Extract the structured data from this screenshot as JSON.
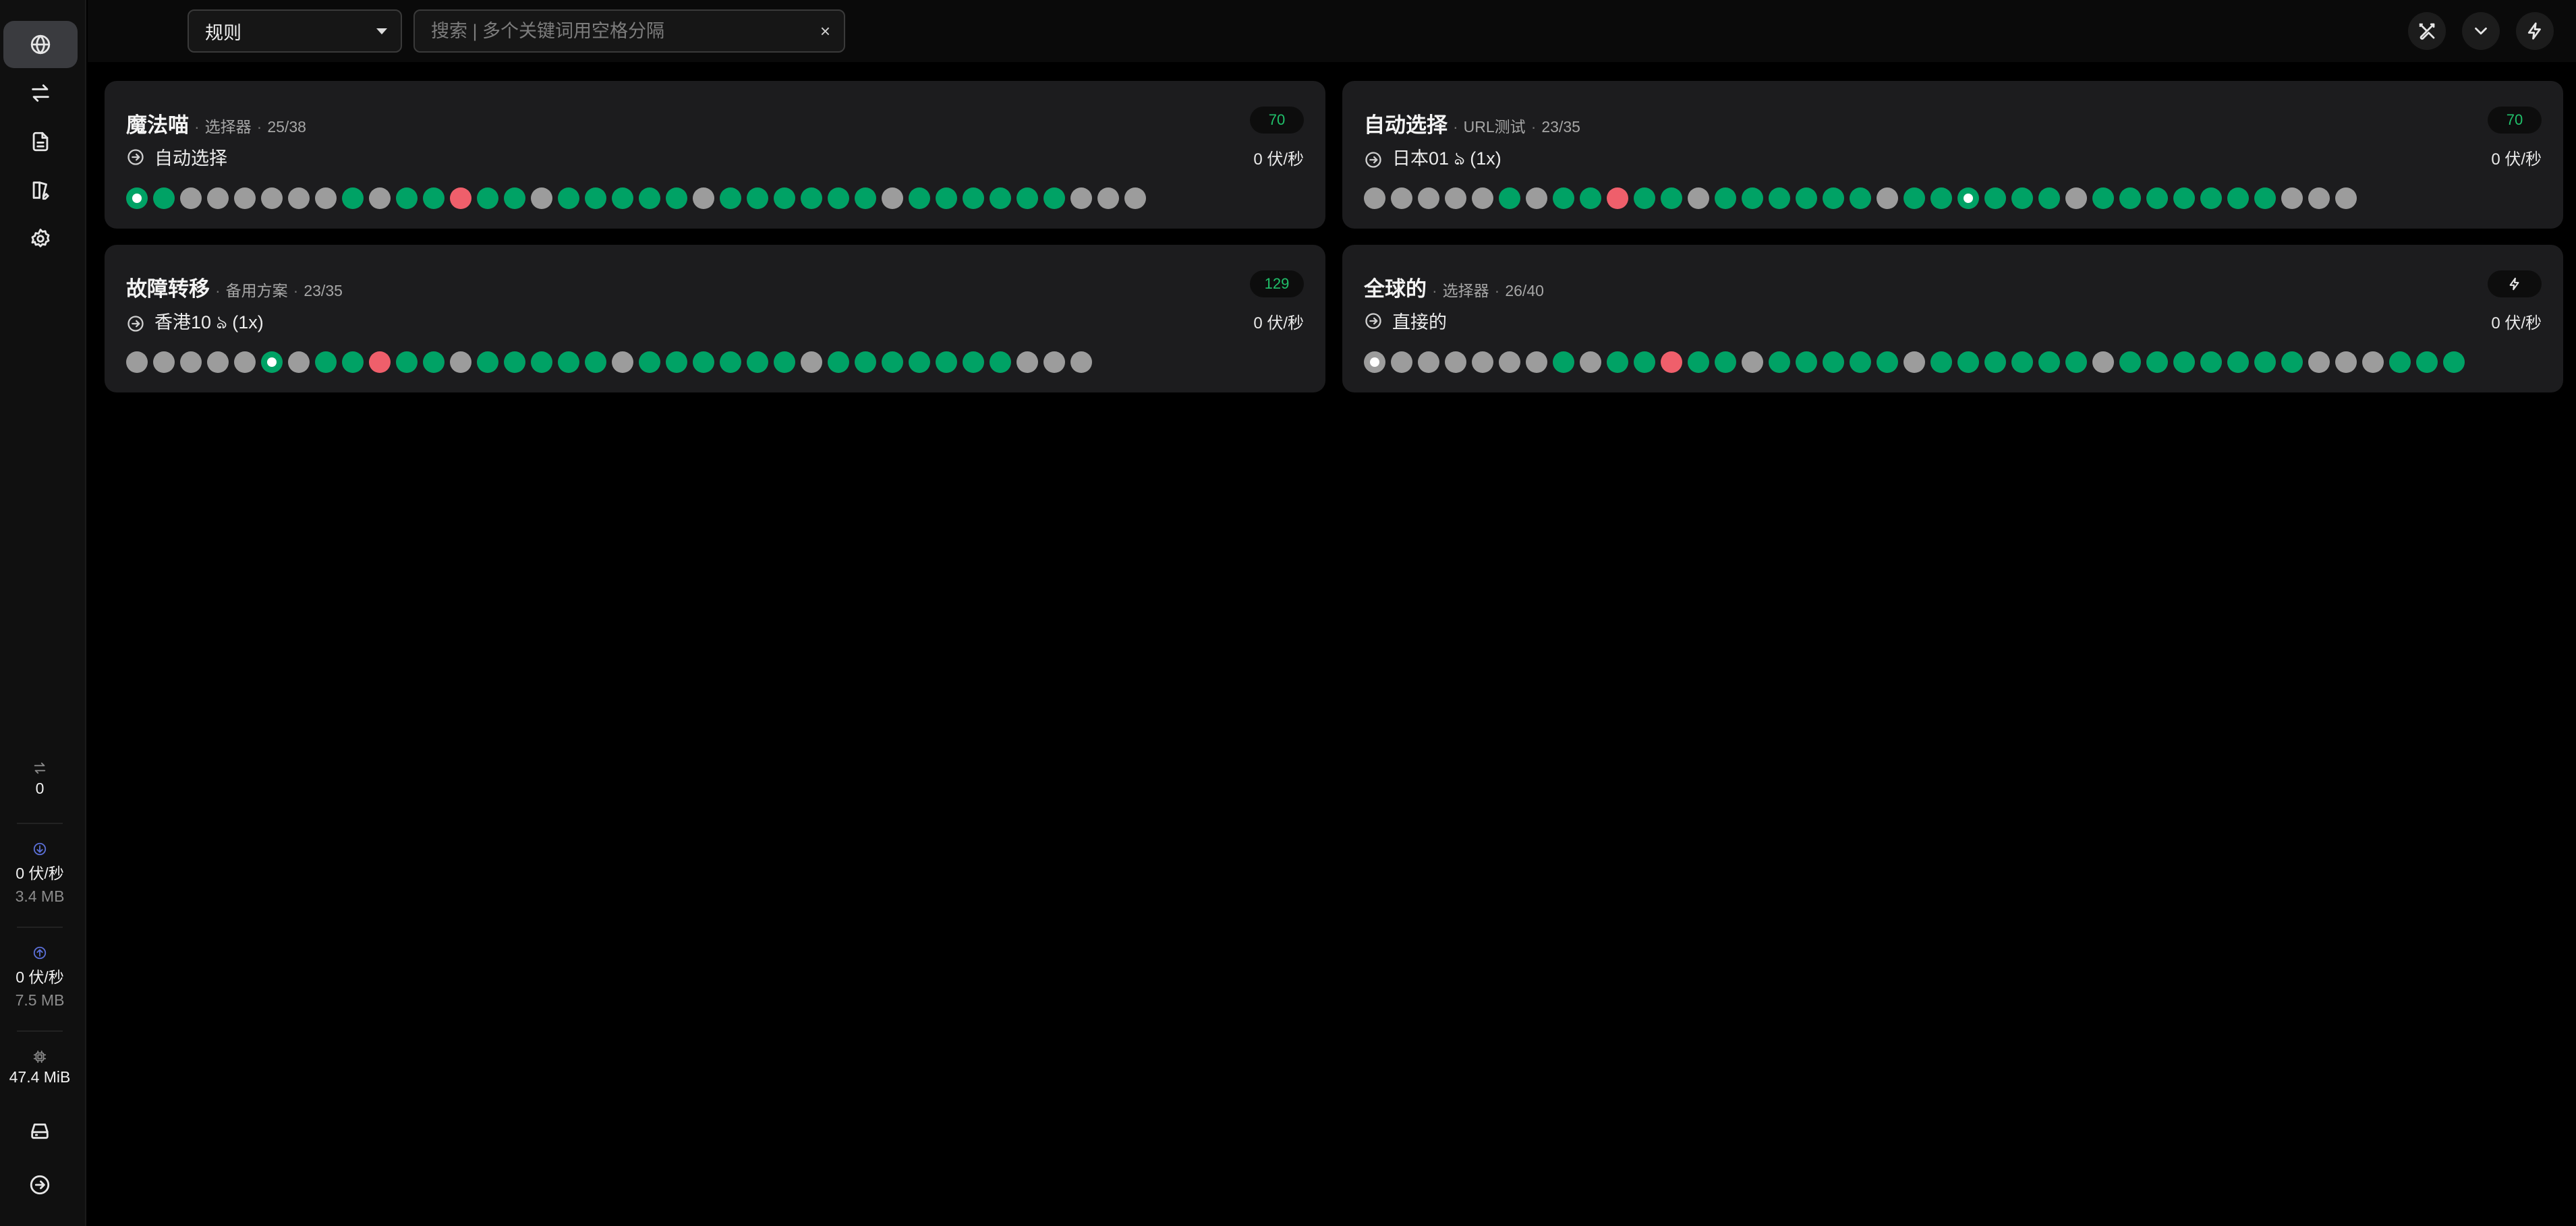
{
  "topbar": {
    "mode_select": "规则",
    "search_placeholder": "搜索 | 多个关键词用空格分隔",
    "search_clear": "×",
    "buttons": [
      "wrench-icon",
      "chevron-down-icon",
      "lightning-icon"
    ]
  },
  "sidebar": {
    "nav": [
      "globe-icon",
      "swap-arrows-icon",
      "document-icon",
      "book-edit-icon",
      "gear-icon"
    ],
    "active_nav": "globe-icon",
    "connections": {
      "icon": "swap-arrows-icon",
      "value": "0"
    },
    "download": {
      "icon": "download-circle-icon",
      "rate": "0 伏/秒",
      "total": "3.4 MB"
    },
    "upload": {
      "icon": "upload-circle-icon",
      "rate": "0 伏/秒",
      "total": "7.5 MB"
    },
    "memory": {
      "icon": "chip-icon",
      "value": "47.4 MiB"
    },
    "bottom": [
      "drive-icon",
      "arrow-right-circle-icon"
    ]
  },
  "colors": {
    "green": "#00a265",
    "gray": "#9c9c9c",
    "red": "#ef5f6b",
    "badge_text": "#20c06a"
  },
  "groups": [
    {
      "name": "魔法喵",
      "type": "选择器",
      "count": "25/38",
      "badge": "70",
      "current": "自动选择",
      "speed": "0 伏/秒",
      "dots": [
        "s",
        "g",
        "x",
        "x",
        "x",
        "x",
        "x",
        "x",
        "g",
        "x",
        "g",
        "g",
        "r",
        "g",
        "g",
        "x",
        "g",
        "g",
        "g",
        "g",
        "g",
        "x",
        "g",
        "g",
        "g",
        "g",
        "g",
        "g",
        "x",
        "g",
        "g",
        "g",
        "g",
        "g",
        "g",
        "x",
        "x",
        "x"
      ]
    },
    {
      "name": "自动选择",
      "type": "URL测试",
      "count": "23/35",
      "badge": "70",
      "current": "日本01 ঌ (1x)",
      "speed": "0 伏/秒",
      "dots": [
        "x",
        "x",
        "x",
        "x",
        "x",
        "g",
        "x",
        "g",
        "g",
        "r",
        "g",
        "g",
        "x",
        "g",
        "g",
        "g",
        "g",
        "g",
        "g",
        "x",
        "g",
        "g",
        "s",
        "g",
        "g",
        "g",
        "x",
        "g",
        "g",
        "g",
        "g",
        "g",
        "g",
        "g",
        "x",
        "x",
        "x"
      ]
    },
    {
      "name": "故障转移",
      "type": "备用方案",
      "count": "23/35",
      "badge": "129",
      "current": "香港10 ঌ (1x)",
      "speed": "0 伏/秒",
      "dots": [
        "x",
        "x",
        "x",
        "x",
        "x",
        "s",
        "x",
        "g",
        "g",
        "r",
        "g",
        "g",
        "x",
        "g",
        "g",
        "g",
        "g",
        "g",
        "x",
        "g",
        "g",
        "g",
        "g",
        "g",
        "g",
        "x",
        "g",
        "g",
        "g",
        "g",
        "g",
        "g",
        "g",
        "x",
        "x",
        "x"
      ]
    },
    {
      "name": "全球的",
      "type": "选择器",
      "count": "26/40",
      "badge_icon": "lightning-icon",
      "current": "直接的",
      "speed": "0 伏/秒",
      "dots": [
        "sx",
        "x",
        "x",
        "x",
        "x",
        "x",
        "x",
        "g",
        "x",
        "g",
        "g",
        "r",
        "g",
        "g",
        "x",
        "g",
        "g",
        "g",
        "g",
        "g",
        "x",
        "g",
        "g",
        "g",
        "g",
        "g",
        "g",
        "x",
        "g",
        "g",
        "g",
        "g",
        "g",
        "g",
        "g",
        "x",
        "x",
        "x",
        "g",
        "g",
        "g"
      ]
    }
  ]
}
